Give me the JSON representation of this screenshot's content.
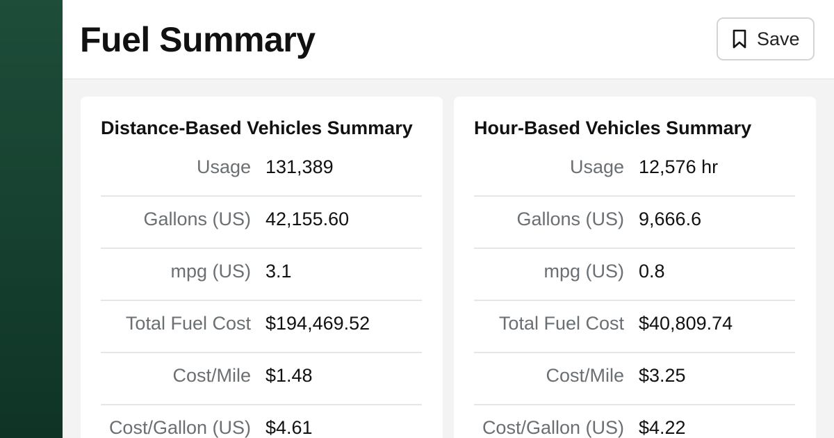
{
  "header": {
    "title": "Fuel Summary",
    "save_label": "Save",
    "save_icon": "bookmark-icon"
  },
  "colors": {
    "sidebar": "#1e4d3a",
    "background": "#f3f3f3",
    "label": "#6a6f73"
  },
  "cards": [
    {
      "title": "Distance-Based Vehicles Summary",
      "rows": [
        {
          "label": "Usage",
          "value": "131,389"
        },
        {
          "label": "Gallons (US)",
          "value": "42,155.60"
        },
        {
          "label": "mpg (US)",
          "value": "3.1"
        },
        {
          "label": "Total Fuel Cost",
          "value": "$194,469.52"
        },
        {
          "label": "Cost/Mile",
          "value": "$1.48"
        },
        {
          "label": "Cost/Gallon (US)",
          "value": "$4.61"
        }
      ]
    },
    {
      "title": "Hour-Based Vehicles Summary",
      "rows": [
        {
          "label": "Usage",
          "value": "12,576 hr"
        },
        {
          "label": "Gallons (US)",
          "value": "9,666.6"
        },
        {
          "label": "mpg (US)",
          "value": "0.8"
        },
        {
          "label": "Total Fuel Cost",
          "value": "$40,809.74"
        },
        {
          "label": "Cost/Mile",
          "value": "$3.25"
        },
        {
          "label": "Cost/Gallon (US)",
          "value": "$4.22"
        }
      ]
    }
  ]
}
